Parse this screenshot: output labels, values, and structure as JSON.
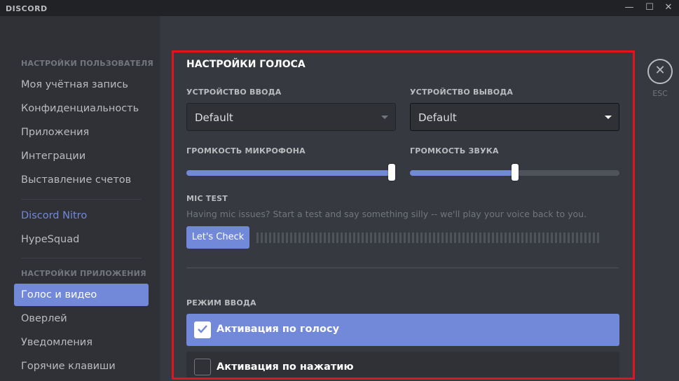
{
  "app": {
    "logo": "DISCORD"
  },
  "window": {
    "minimize_icon": "minimize-icon",
    "maximize_icon": "maximize-icon",
    "close_icon": "close-icon"
  },
  "sidebar": {
    "user_settings_header": "НАСТРОЙКИ ПОЛЬЗОВАТЕЛЯ",
    "user_items": [
      "Моя учётная запись",
      "Конфиденциальность",
      "Приложения",
      "Интеграции",
      "Выставление счетов"
    ],
    "nitro": "Discord Nitro",
    "hypesquad": "HypeSquad",
    "app_settings_header": "НАСТРОЙКИ ПРИЛОЖЕНИЯ",
    "app_items": [
      "Голос и видео",
      "Оверлей",
      "Уведомления",
      "Горячие клавиши"
    ],
    "active_item": "Голос и видео"
  },
  "main": {
    "title": "НАСТРОЙКИ ГОЛОСА",
    "input_device_label": "УСТРОЙСТВО ВВОДА",
    "input_device_value": "Default",
    "output_device_label": "УСТРОЙСТВО ВЫВОДА",
    "output_device_value": "Default",
    "mic_volume_label": "ГРОМКОСТЬ МИКРОФОНА",
    "mic_volume_fraction": 1.0,
    "sound_volume_label": "ГРОМКОСТЬ ЗВУКА",
    "sound_volume_fraction": 0.5,
    "mic_test_label": "MIC TEST",
    "mic_test_help": "Having mic issues? Start a test and say something silly -- we'll play your voice back to you.",
    "check_button": "Let's Check",
    "input_mode_label": "РЕЖИМ ВВОДА",
    "modes": [
      {
        "label": "Активация по голосу",
        "checked": true
      },
      {
        "label": "Активация по нажатию",
        "checked": false
      }
    ]
  },
  "esc": {
    "label": "ESC",
    "icon": "close-icon"
  },
  "colors": {
    "accent": "#7289da",
    "highlight": "#e0161b",
    "background": "#36393f",
    "sidebar": "#2f3136"
  }
}
